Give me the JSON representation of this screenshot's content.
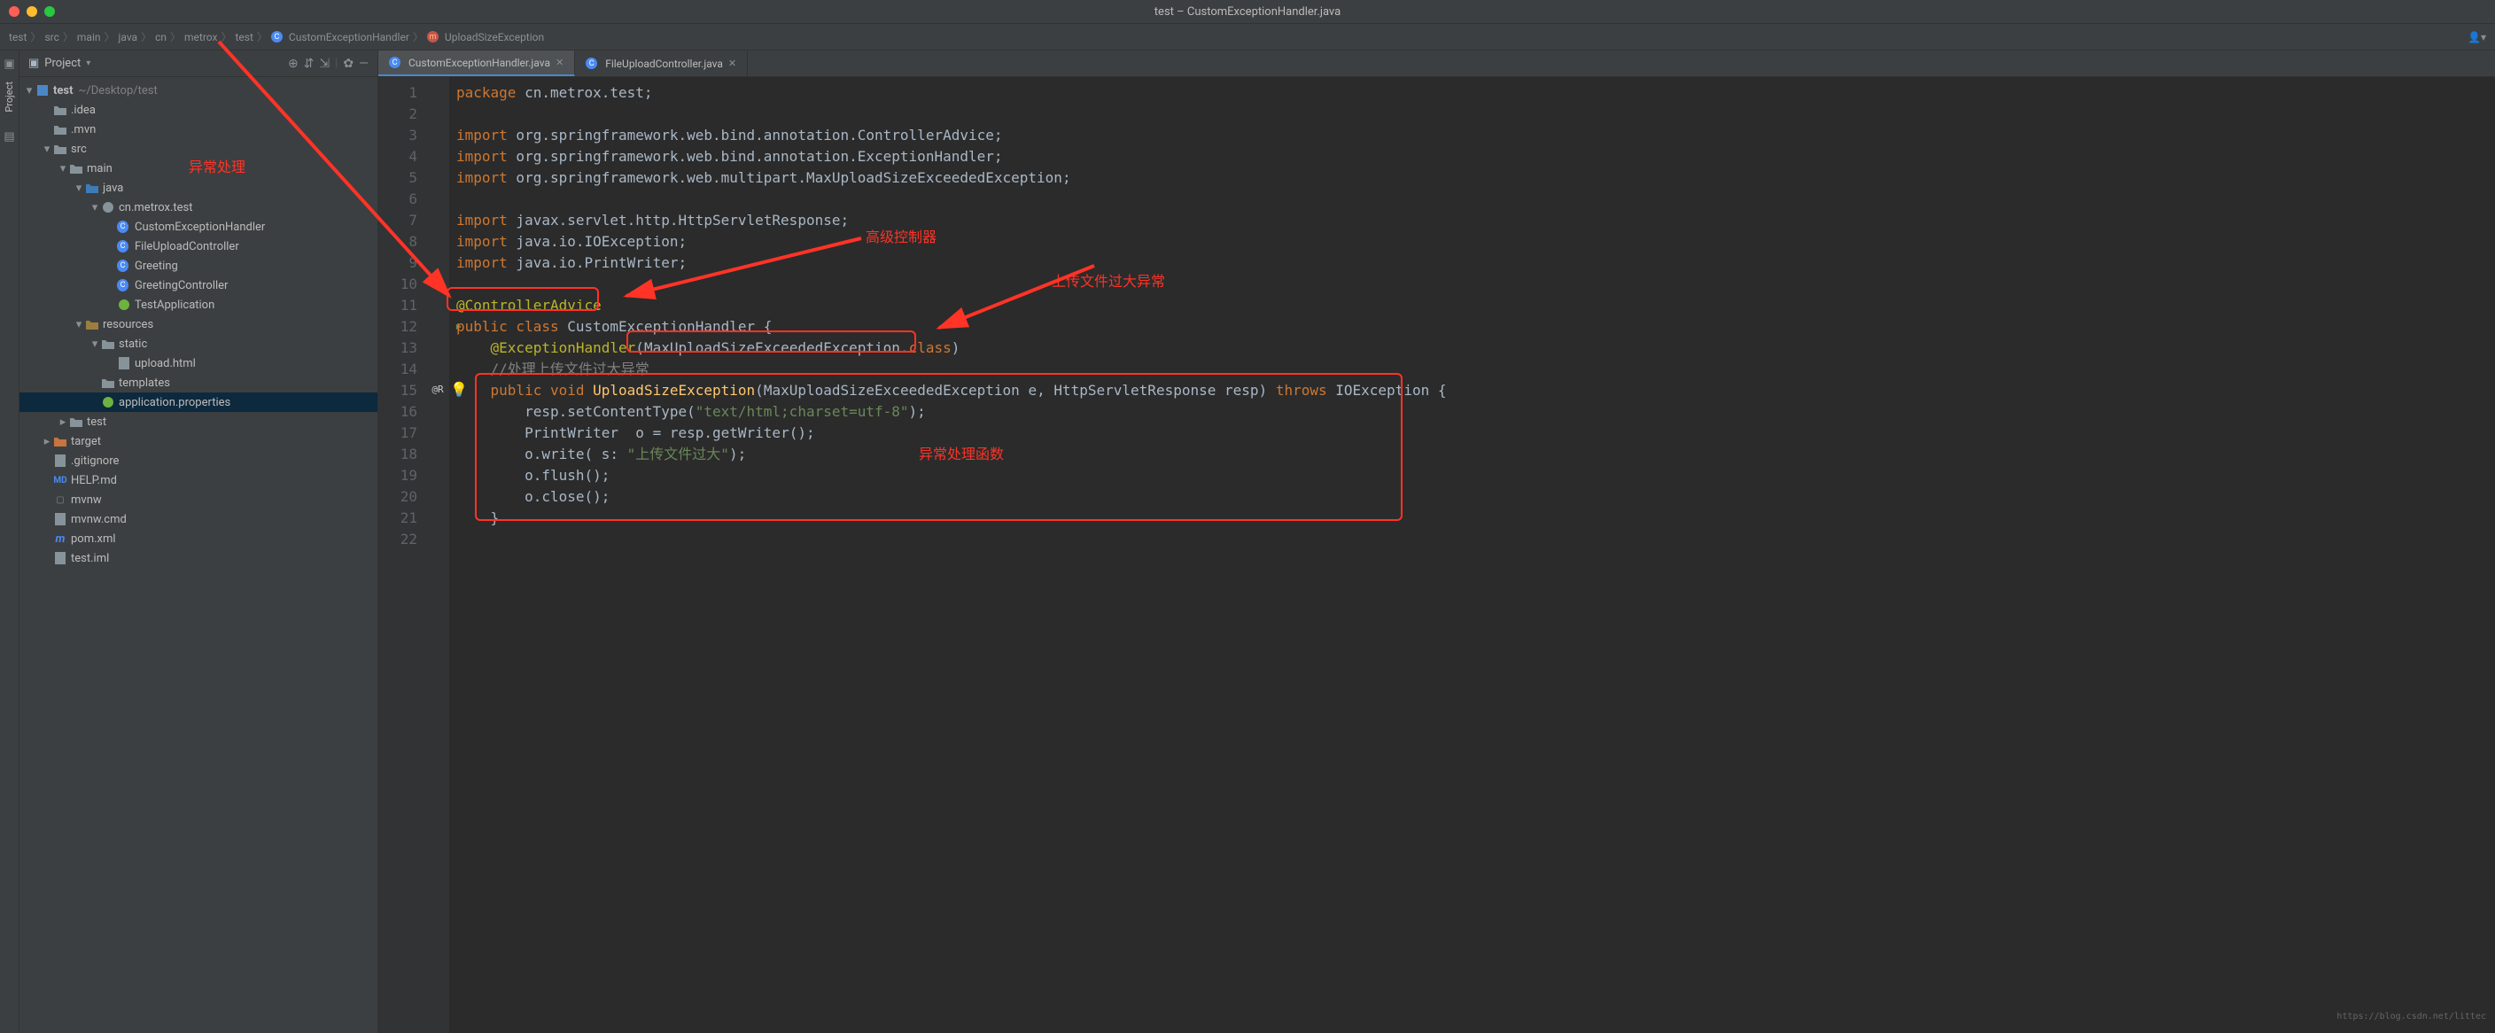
{
  "window_title": "test – CustomExceptionHandler.java",
  "breadcrumb": [
    "test",
    "src",
    "main",
    "java",
    "cn",
    "metrox",
    "test",
    "CustomExceptionHandler",
    "UploadSizeException"
  ],
  "project_pane": {
    "title": "Project",
    "root_label": "test",
    "root_sub": "~/Desktop/test",
    "items": [
      {
        "indent": 1,
        "arrow": "",
        "icon": "folder",
        "label": ".idea"
      },
      {
        "indent": 1,
        "arrow": "",
        "icon": "folder",
        "label": ".mvn"
      },
      {
        "indent": 1,
        "arrow": "v",
        "icon": "folder",
        "label": "src"
      },
      {
        "indent": 2,
        "arrow": "v",
        "icon": "folder",
        "label": "main"
      },
      {
        "indent": 3,
        "arrow": "v",
        "icon": "folder-src",
        "label": "java"
      },
      {
        "indent": 4,
        "arrow": "v",
        "icon": "package",
        "label": "cn.metrox.test"
      },
      {
        "indent": 5,
        "arrow": "",
        "icon": "class",
        "label": "CustomExceptionHandler"
      },
      {
        "indent": 5,
        "arrow": "",
        "icon": "class",
        "label": "FileUploadController"
      },
      {
        "indent": 5,
        "arrow": "",
        "icon": "class",
        "label": "Greeting"
      },
      {
        "indent": 5,
        "arrow": "",
        "icon": "class",
        "label": "GreetingController"
      },
      {
        "indent": 5,
        "arrow": "",
        "icon": "spring",
        "label": "TestApplication"
      },
      {
        "indent": 3,
        "arrow": "v",
        "icon": "folder-res",
        "label": "resources"
      },
      {
        "indent": 4,
        "arrow": "v",
        "icon": "folder",
        "label": "static"
      },
      {
        "indent": 5,
        "arrow": "",
        "icon": "html",
        "label": "upload.html"
      },
      {
        "indent": 4,
        "arrow": "",
        "icon": "folder",
        "label": "templates"
      },
      {
        "indent": 4,
        "arrow": "",
        "icon": "spring-prop",
        "label": "application.properties",
        "selected": true
      },
      {
        "indent": 2,
        "arrow": ">",
        "icon": "folder",
        "label": "test"
      },
      {
        "indent": 1,
        "arrow": ">",
        "icon": "folder-target",
        "label": "target"
      },
      {
        "indent": 1,
        "arrow": "",
        "icon": "file",
        "label": ".gitignore"
      },
      {
        "indent": 1,
        "arrow": "",
        "icon": "md",
        "label": "HELP.md"
      },
      {
        "indent": 1,
        "arrow": "",
        "icon": "sh",
        "label": "mvnw"
      },
      {
        "indent": 1,
        "arrow": "",
        "icon": "file",
        "label": "mvnw.cmd"
      },
      {
        "indent": 1,
        "arrow": "",
        "icon": "maven",
        "label": "pom.xml"
      },
      {
        "indent": 1,
        "arrow": "",
        "icon": "file",
        "label": "test.iml"
      }
    ]
  },
  "tabs": [
    {
      "label": "CustomExceptionHandler.java",
      "active": true
    },
    {
      "label": "FileUploadController.java",
      "active": false
    }
  ],
  "line_numbers": [
    "1",
    "2",
    "3",
    "4",
    "5",
    "6",
    "7",
    "8",
    "9",
    "10",
    "11",
    "12",
    "13",
    "14",
    "15",
    "16",
    "17",
    "18",
    "19",
    "20",
    "21",
    "22"
  ],
  "gutter_markers": {
    "15": "@R"
  },
  "code_tokens": {
    "l1": [
      [
        "kw",
        "package"
      ],
      [
        "",
        " cn.metrox.test;"
      ]
    ],
    "l3": [
      [
        "kw",
        "import"
      ],
      [
        "",
        " org.springframework.web.bind.annotation."
      ],
      [
        "cls",
        "ControllerAdvice"
      ],
      [
        "",
        ";"
      ]
    ],
    "l4": [
      [
        "kw",
        "import"
      ],
      [
        "",
        " org.springframework.web.bind.annotation."
      ],
      [
        "cls",
        "ExceptionHandler"
      ],
      [
        "",
        ";"
      ]
    ],
    "l5": [
      [
        "kw",
        "import"
      ],
      [
        "",
        " org.springframework.web.multipart."
      ],
      [
        "cls",
        "MaxUploadSizeExceededException"
      ],
      [
        "",
        ";"
      ]
    ],
    "l7": [
      [
        "kw",
        "import"
      ],
      [
        "",
        " javax.servlet.http."
      ],
      [
        "cls",
        "HttpServletResponse"
      ],
      [
        "",
        ";"
      ]
    ],
    "l8": [
      [
        "kw",
        "import"
      ],
      [
        "",
        " java.io."
      ],
      [
        "cls",
        "IOException"
      ],
      [
        "",
        ";"
      ]
    ],
    "l9": [
      [
        "kw",
        "import"
      ],
      [
        "",
        " java.io."
      ],
      [
        "cls",
        "PrintWriter"
      ],
      [
        "",
        ";"
      ]
    ],
    "l11": [
      [
        "ann",
        "@ControllerAdvice"
      ]
    ],
    "l12": [
      [
        "kw",
        "public class"
      ],
      [
        "",
        " "
      ],
      [
        "cls",
        "CustomExceptionHandler"
      ],
      [
        "",
        " {"
      ]
    ],
    "l13": [
      [
        "",
        "    "
      ],
      [
        "ann",
        "@ExceptionHandler"
      ],
      [
        "",
        "("
      ],
      [
        "cls",
        "MaxUploadSizeExceededException"
      ],
      [
        "",
        "."
      ],
      [
        "kw",
        "class"
      ],
      [
        "",
        ")"
      ]
    ],
    "l14": [
      [
        "",
        "    "
      ],
      [
        "cmt",
        "//处理上传文件过大异常"
      ]
    ],
    "l15": [
      [
        "",
        "    "
      ],
      [
        "kw",
        "public void"
      ],
      [
        "",
        " "
      ],
      [
        "method",
        "UploadSizeException"
      ],
      [
        "",
        "("
      ],
      [
        "cls",
        "MaxUploadSizeExceededException"
      ],
      [
        "",
        " "
      ],
      [
        "param",
        "e"
      ],
      [
        "",
        ", "
      ],
      [
        "cls",
        "HttpServletResponse"
      ],
      [
        "",
        " "
      ],
      [
        "param",
        "resp"
      ],
      [
        "",
        ") "
      ],
      [
        "throws",
        "throws"
      ],
      [
        "",
        " "
      ],
      [
        "cls",
        "IOException"
      ],
      [
        "",
        " {"
      ]
    ],
    "l16": [
      [
        "",
        "        resp.setContentType("
      ],
      [
        "str",
        "\"text/html;charset=utf-8\""
      ],
      [
        "",
        ");"
      ]
    ],
    "l17": [
      [
        "",
        "        "
      ],
      [
        "cls",
        "PrintWriter"
      ],
      [
        "",
        "  "
      ],
      [
        "param",
        "o"
      ],
      [
        "",
        " = resp.getWriter();"
      ]
    ],
    "l18": [
      [
        "",
        "        o.write( "
      ],
      [
        "param",
        "s:"
      ],
      [
        "",
        " "
      ],
      [
        "str",
        "\"上传文件过大\""
      ],
      [
        "",
        ");"
      ]
    ],
    "l19": [
      [
        "",
        "        o.flush();"
      ]
    ],
    "l20": [
      [
        "",
        "        o.close();"
      ]
    ],
    "l21": [
      [
        "",
        "    }"
      ]
    ]
  },
  "annotations": {
    "label1": "异常处理",
    "label2": "高级控制器",
    "label3": "上传文件过大异常",
    "label4": "异常处理函数"
  },
  "watermark": "https://blog.csdn.net/littec"
}
